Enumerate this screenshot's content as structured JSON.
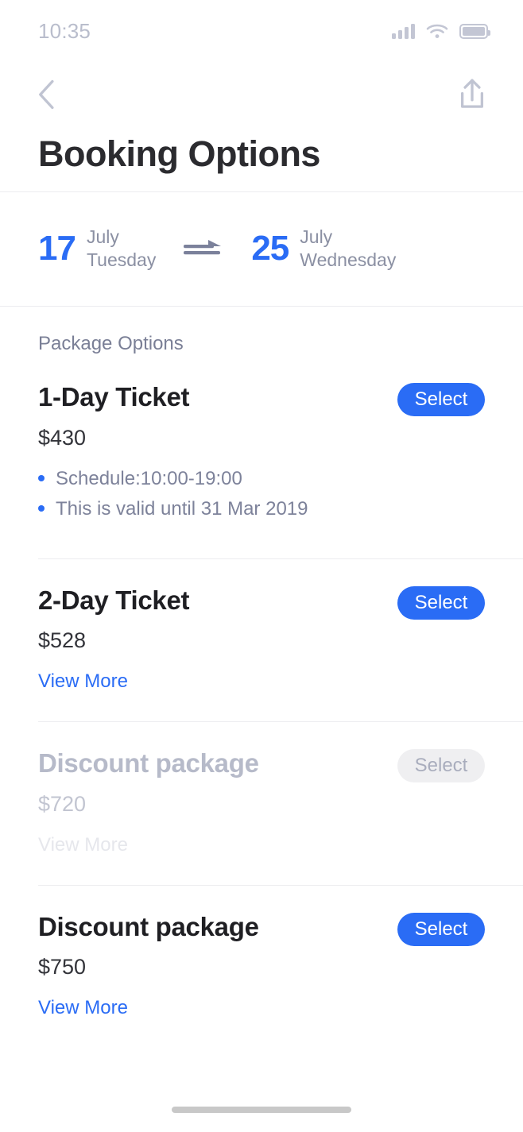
{
  "status_bar": {
    "time": "10:35",
    "icons": [
      "cellular-signal-icon",
      "wifi-icon",
      "battery-icon"
    ]
  },
  "nav_bar": {
    "back_icon": "chevron-left-icon",
    "share_icon": "share-upload-icon"
  },
  "header": {
    "title": "Booking Options"
  },
  "date_range": {
    "start": {
      "day": "17",
      "month": "July",
      "weekday": "Tuesday"
    },
    "separator_icon": "arrow-right-icon",
    "end": {
      "day": "25",
      "month": "July",
      "weekday": "Wednesday"
    }
  },
  "packages_section": {
    "label": "Package Options",
    "items": [
      {
        "title": "1-Day Ticket",
        "price": "$430",
        "select_label": "Select",
        "enabled": true,
        "bullets": [
          "Schedule:10:00-19:00",
          "This is valid until 31 Mar 2019"
        ],
        "view_more_label": ""
      },
      {
        "title": "2-Day Ticket",
        "price": "$528",
        "select_label": "Select",
        "enabled": true,
        "bullets": [],
        "view_more_label": "View More"
      },
      {
        "title": "Discount package",
        "price": "$720",
        "select_label": "Select",
        "enabled": false,
        "bullets": [],
        "view_more_label": "View More"
      },
      {
        "title": "Discount package",
        "price": "$750",
        "select_label": "Select",
        "enabled": true,
        "bullets": [],
        "view_more_label": "View More"
      }
    ]
  },
  "colors": {
    "accent_blue": "#2a6cf5",
    "title_dark": "#1f1f23",
    "muted_gray": "#7d829a",
    "disabled_gray": "#b6bac9",
    "divider": "#ededf0"
  },
  "home_indicator": "home-indicator-bar"
}
